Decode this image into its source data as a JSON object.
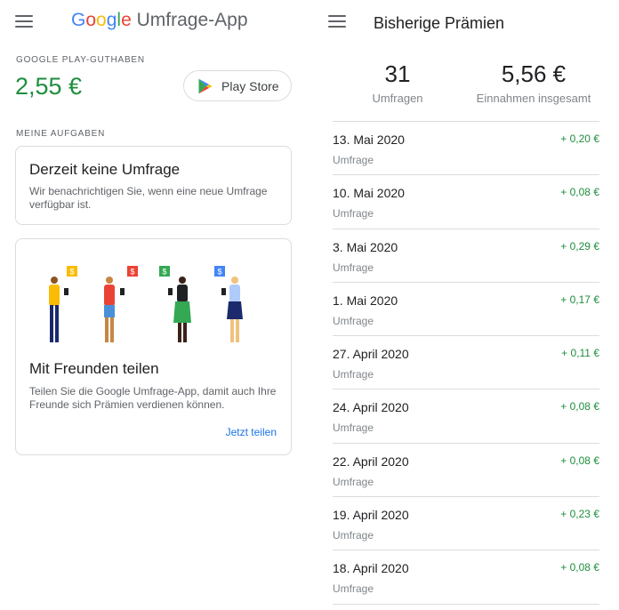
{
  "left": {
    "app_brand": "Google",
    "app_name": "Umfrage-App",
    "credit_label": "GOOGLE PLAY-GUTHABEN",
    "balance": "2,55 €",
    "play_button": "Play Store",
    "tasks_label": "MEINE AUFGABEN",
    "survey_card": {
      "title": "Derzeit keine Umfrage",
      "text": "Wir benachrichtigen Sie, wenn eine neue Umfrage verfügbar ist."
    },
    "share_card": {
      "title": "Mit Freunden teilen",
      "text": "Teilen Sie die Google Umfrage-App, damit auch Ihre Freunde sich Prämien verdienen können.",
      "link": "Jetzt teilen"
    }
  },
  "right": {
    "title": "Bisherige Prämien",
    "stats": {
      "count": "31",
      "count_label": "Umfragen",
      "total": "5,56 €",
      "total_label": "Einnahmen insgesamt"
    },
    "rewards": [
      {
        "date": "13. Mai 2020",
        "type": "Umfrage",
        "amount": "+ 0,20 €"
      },
      {
        "date": "10. Mai 2020",
        "type": "Umfrage",
        "amount": "+ 0,08 €"
      },
      {
        "date": "3. Mai 2020",
        "type": "Umfrage",
        "amount": "+ 0,29 €"
      },
      {
        "date": "1. Mai 2020",
        "type": "Umfrage",
        "amount": "+ 0,17 €"
      },
      {
        "date": "27. April 2020",
        "type": "Umfrage",
        "amount": "+ 0,11 €"
      },
      {
        "date": "24. April 2020",
        "type": "Umfrage",
        "amount": "+ 0,08 €"
      },
      {
        "date": "22. April 2020",
        "type": "Umfrage",
        "amount": "+ 0,08 €"
      },
      {
        "date": "19. April 2020",
        "type": "Umfrage",
        "amount": "+ 0,23 €"
      },
      {
        "date": "18. April 2020",
        "type": "Umfrage",
        "amount": "+ 0,08 €"
      }
    ]
  },
  "icons": {
    "menu": "menu-icon",
    "play_store": "play-store-icon",
    "illustration": "people-sharing-illustration"
  },
  "colors": {
    "money_green": "#1e8e3e",
    "link_blue": "#1a73e8",
    "google_blue": "#4285f4",
    "google_red": "#ea4335",
    "google_yellow": "#fbbc05",
    "google_green": "#34a853"
  }
}
